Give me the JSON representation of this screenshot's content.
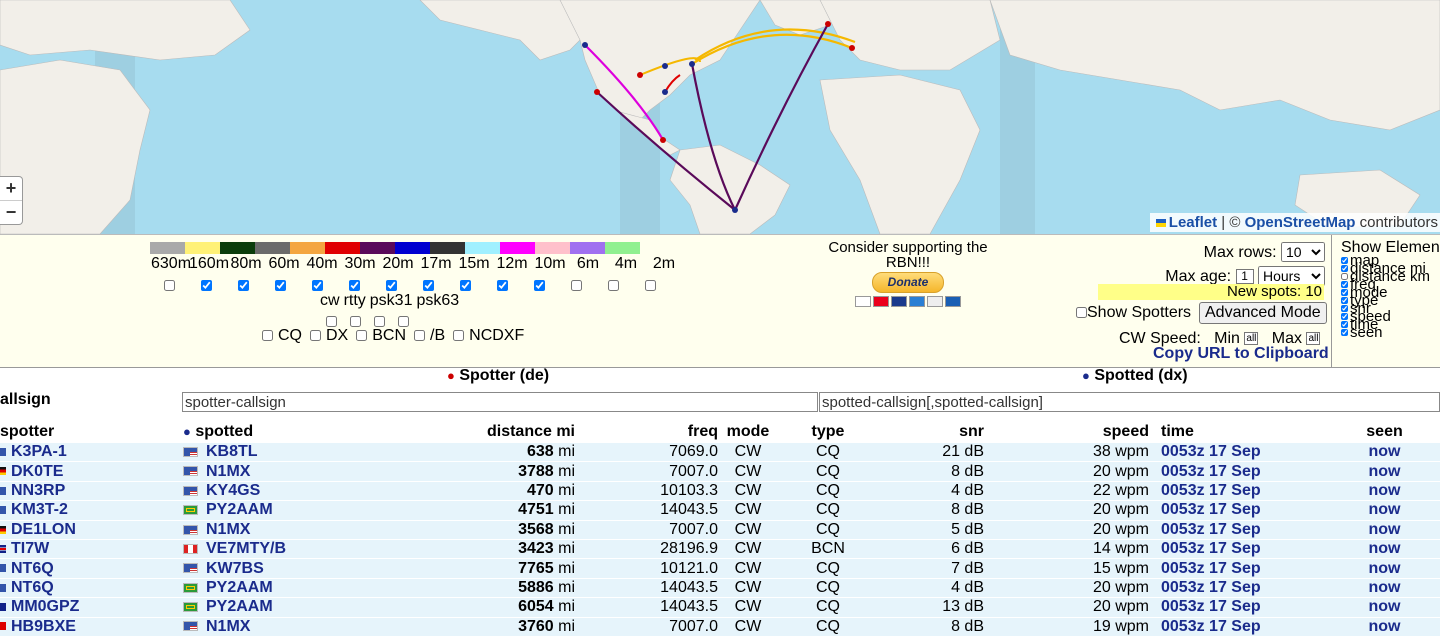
{
  "map": {
    "zoom_in": "+",
    "zoom_out": "−",
    "attribution_leaflet": "Leaflet",
    "attribution_sep": " | © ",
    "attribution_osm": "OpenStreetMap",
    "attribution_tail": " contributors"
  },
  "bands": {
    "labels": [
      "630m",
      "160m",
      "80m",
      "60m",
      "40m",
      "30m",
      "20m",
      "17m",
      "15m",
      "12m",
      "10m",
      "6m",
      "4m",
      "2m"
    ],
    "colors": [
      "#a9a9a9",
      "#fff176",
      "#0b3d0b",
      "#6b6b6b",
      "#f4a640",
      "#e00000",
      "#5a0a5a",
      "#0000d0",
      "#333333",
      "#a0f0ff",
      "#ff00ff",
      "#ffc0cb",
      "#a070f0",
      "#90f090"
    ],
    "checked": [
      false,
      true,
      true,
      true,
      true,
      true,
      true,
      true,
      true,
      true,
      true,
      false,
      false,
      false
    ]
  },
  "modes": {
    "labels": [
      "cw",
      "rtty",
      "psk31",
      "psk63"
    ],
    "specials": [
      "CQ",
      "DX",
      "BCN",
      "/B",
      "NCDXF"
    ]
  },
  "support": {
    "text": "Consider supporting the RBN!!!",
    "donate": "Donate"
  },
  "settings": {
    "max_rows_label": "Max rows:",
    "max_rows_value": "10",
    "max_age_label": "Max age:",
    "max_age_value": "1",
    "max_age_unit": "Hours",
    "new_spots": "New spots: 10",
    "show_spotters": "Show Spotters",
    "advanced_mode": "Advanced Mode",
    "cw_speed": "CW Speed:",
    "min": "Min",
    "max": "Max",
    "all": "all",
    "copy_url": "Copy URL to Clipboard"
  },
  "elements": {
    "title": "Show Elements",
    "items": [
      "map",
      "distance mi",
      "distance km",
      "freq",
      "mode",
      "type",
      "snr",
      "speed",
      "time",
      "seen"
    ],
    "checked": [
      true,
      true,
      false,
      true,
      true,
      true,
      true,
      true,
      true,
      true
    ]
  },
  "sections": {
    "spotter": "Spotter (de)",
    "spotted": "Spotted (dx)"
  },
  "filters": {
    "callsign_label": "allsign",
    "spotter_placeholder": "spotter-callsign",
    "spotted_placeholder": "spotted-callsign[,spotted-callsign]"
  },
  "table": {
    "headers": {
      "spotter": "spotter",
      "spotted": "spotted",
      "distance": "distance mi",
      "freq": "freq",
      "mode": "mode",
      "type": "type",
      "snr": "snr",
      "speed": "speed",
      "time": "time",
      "seen": "seen"
    },
    "rows": [
      {
        "spotter": "K3PA-1",
        "sflag": "us",
        "spotted": "KB8TL",
        "flag": "us",
        "distance": "638",
        "unit": "mi",
        "freq": "7069.0",
        "mode": "CW",
        "type": "CQ",
        "snr": "21 dB",
        "speed": "38 wpm",
        "time": "0053z 17 Sep",
        "seen": "now"
      },
      {
        "spotter": "DK0TE",
        "sflag": "de",
        "spotted": "N1MX",
        "flag": "us",
        "distance": "3788",
        "unit": "mi",
        "freq": "7007.0",
        "mode": "CW",
        "type": "CQ",
        "snr": "8 dB",
        "speed": "20 wpm",
        "time": "0053z 17 Sep",
        "seen": "now"
      },
      {
        "spotter": "NN3RP",
        "sflag": "us",
        "spotted": "KY4GS",
        "flag": "us",
        "distance": "470",
        "unit": "mi",
        "freq": "10103.3",
        "mode": "CW",
        "type": "CQ",
        "snr": "4 dB",
        "speed": "22 wpm",
        "time": "0053z 17 Sep",
        "seen": "now"
      },
      {
        "spotter": "KM3T-2",
        "sflag": "us",
        "spotted": "PY2AAM",
        "flag": "br",
        "distance": "4751",
        "unit": "mi",
        "freq": "14043.5",
        "mode": "CW",
        "type": "CQ",
        "snr": "8 dB",
        "speed": "20 wpm",
        "time": "0053z 17 Sep",
        "seen": "now"
      },
      {
        "spotter": "DE1LON",
        "sflag": "de",
        "spotted": "N1MX",
        "flag": "us",
        "distance": "3568",
        "unit": "mi",
        "freq": "7007.0",
        "mode": "CW",
        "type": "CQ",
        "snr": "5 dB",
        "speed": "20 wpm",
        "time": "0053z 17 Sep",
        "seen": "now"
      },
      {
        "spotter": "TI7W",
        "sflag": "cr",
        "spotted": "VE7MTY/B",
        "flag": "ca",
        "distance": "3423",
        "unit": "mi",
        "freq": "28196.9",
        "mode": "CW",
        "type": "BCN",
        "snr": "6 dB",
        "speed": "14 wpm",
        "time": "0053z 17 Sep",
        "seen": "now"
      },
      {
        "spotter": "NT6Q",
        "sflag": "us",
        "spotted": "KW7BS",
        "flag": "us",
        "distance": "7765",
        "unit": "mi",
        "freq": "10121.0",
        "mode": "CW",
        "type": "CQ",
        "snr": "7 dB",
        "speed": "15 wpm",
        "time": "0053z 17 Sep",
        "seen": "now"
      },
      {
        "spotter": "NT6Q",
        "sflag": "us",
        "spotted": "PY2AAM",
        "flag": "br",
        "distance": "5886",
        "unit": "mi",
        "freq": "14043.5",
        "mode": "CW",
        "type": "CQ",
        "snr": "4 dB",
        "speed": "20 wpm",
        "time": "0053z 17 Sep",
        "seen": "now"
      },
      {
        "spotter": "MM0GPZ",
        "sflag": "gb",
        "spotted": "PY2AAM",
        "flag": "br",
        "distance": "6054",
        "unit": "mi",
        "freq": "14043.5",
        "mode": "CW",
        "type": "CQ",
        "snr": "13 dB",
        "speed": "20 wpm",
        "time": "0053z 17 Sep",
        "seen": "now"
      },
      {
        "spotter": "HB9BXE",
        "sflag": "ch",
        "spotted": "N1MX",
        "flag": "us",
        "distance": "3760",
        "unit": "mi",
        "freq": "7007.0",
        "mode": "CW",
        "type": "CQ",
        "snr": "8 dB",
        "speed": "19 wpm",
        "time": "0053z 17 Sep",
        "seen": "now"
      }
    ]
  }
}
